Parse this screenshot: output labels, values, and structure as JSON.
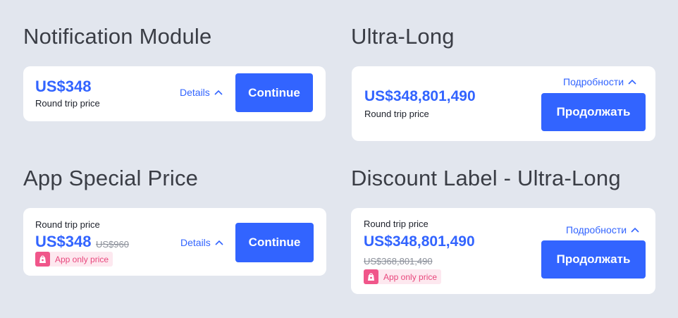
{
  "sections": {
    "notification": {
      "title": "Notification Module",
      "price": "US$348",
      "price_label": "Round trip price",
      "details_label": "Details",
      "button_label": "Continue"
    },
    "ultra_long": {
      "title": "Ultra-Long",
      "price": "US$348,801,490",
      "price_label": "Round trip price",
      "details_label": "Подробности",
      "button_label": "Продолжать"
    },
    "app_special": {
      "title": "App Special Price",
      "price_label": "Round trip price",
      "price": "US$348",
      "original_price": "US$960",
      "badge_label": "App only price",
      "details_label": "Details",
      "button_label": "Continue"
    },
    "discount_ultra_long": {
      "title": "Discount Label - Ultra-Long",
      "price_label": "Round trip price",
      "price": "US$348,801,490",
      "original_price": "US$368,801,490",
      "badge_label": "App only price",
      "details_label": "Подробности",
      "button_label": "Продолжать"
    }
  },
  "icons": {
    "details_chevron": "chevron-up-icon",
    "badge": "shopping-bag-icon"
  },
  "colors": {
    "background": "#e2e6ee",
    "accent": "#3264ff",
    "badge_bg": "#fde8ef",
    "badge_icon": "#f0568a",
    "badge_text": "#e8467c",
    "strike_text": "#8a8f99"
  }
}
